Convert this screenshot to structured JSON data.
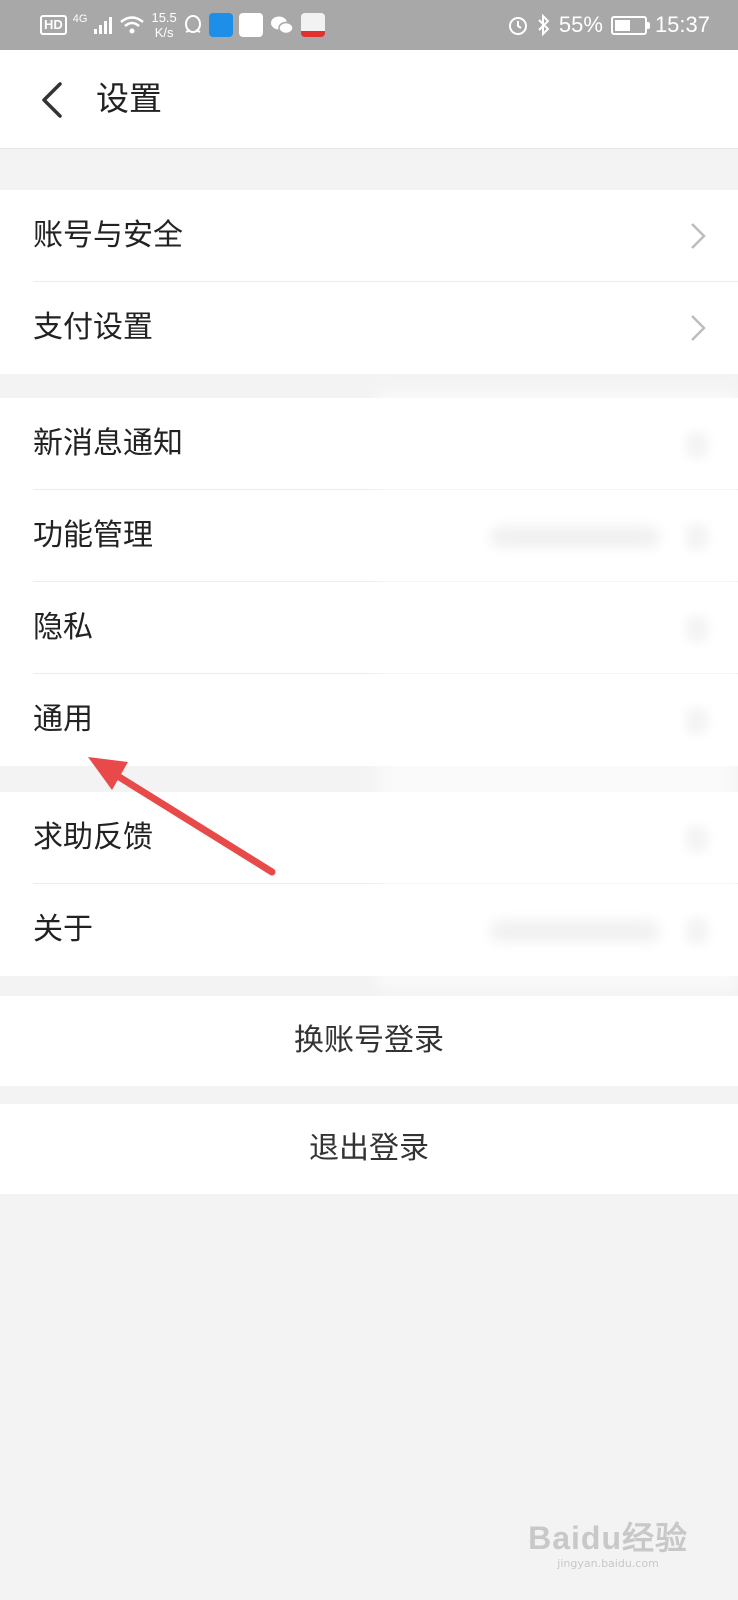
{
  "status_bar": {
    "hd": "HD",
    "network": "4G",
    "speed_value": "15.5",
    "speed_unit": "K/s",
    "battery": "55%",
    "battery_level": 0.55,
    "time": "15:37"
  },
  "header": {
    "title": "设置"
  },
  "groups": [
    {
      "items": [
        {
          "label": "账号与安全"
        },
        {
          "label": "支付设置"
        }
      ]
    },
    {
      "items": [
        {
          "label": "新消息通知"
        },
        {
          "label": "功能管理"
        },
        {
          "label": "隐私"
        },
        {
          "label": "通用"
        }
      ]
    },
    {
      "items": [
        {
          "label": "求助反馈"
        },
        {
          "label": "关于"
        }
      ]
    }
  ],
  "buttons": {
    "switch_account": "换账号登录",
    "logout": "退出登录"
  },
  "watermark": {
    "main": "Baidu经验",
    "sub": "jingyan.baidu.com"
  },
  "colors": {
    "status_bar": "#a8a8a8",
    "background": "#f3f3f3",
    "annotation_arrow": "#e84a4a"
  },
  "icons": [
    "qq-icon",
    "wechat-icon",
    "alarm-icon",
    "bluetooth-icon",
    "back-arrow-icon",
    "chevron-right-icon"
  ]
}
